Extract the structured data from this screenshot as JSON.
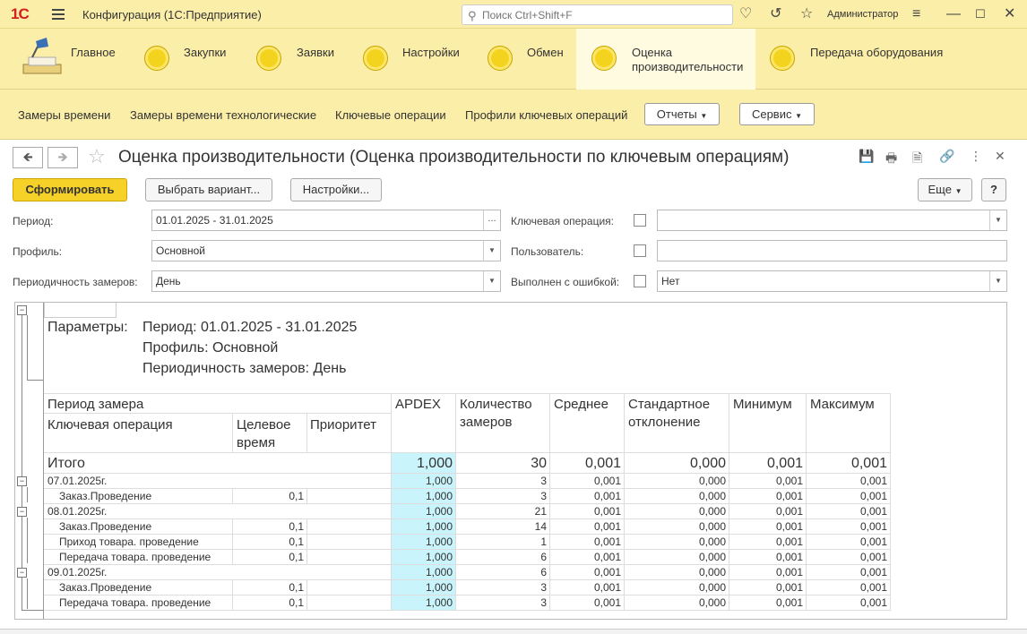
{
  "titlebar": {
    "logo": "1С",
    "app_title": "Конфигурация  (1С:Предприятие)",
    "search_placeholder": "Поиск Ctrl+Shift+F",
    "user": "Администратор"
  },
  "sections": [
    {
      "label": "Главное"
    },
    {
      "label": "Закупки"
    },
    {
      "label": "Заявки"
    },
    {
      "label": "Настройки"
    },
    {
      "label": "Обмен"
    },
    {
      "label_line1": "Оценка",
      "label_line2": "производительности"
    },
    {
      "label": "Передача оборудования"
    }
  ],
  "subnav": {
    "links": [
      "Замеры времени",
      "Замеры времени технологические",
      "Ключевые операции",
      "Профили ключевых операций"
    ],
    "reports": "Отчеты",
    "service": "Сервис"
  },
  "form": {
    "title": "Оценка производительности (Оценка производительности по ключевым операциям)",
    "generate": "Сформировать",
    "choose_variant": "Выбрать вариант...",
    "settings": "Настройки...",
    "more": "Еще",
    "help": "?",
    "period_label": "Период:",
    "period_value": "01.01.2025 - 31.01.2025",
    "period_btn": "...",
    "profile_label": "Профиль:",
    "profile_value": "Основной",
    "periodicity_label": "Периодичность замеров:",
    "periodicity_value": "День",
    "keyop_label": "Ключевая операция:",
    "keyop_value": "",
    "user_label": "Пользователь:",
    "user_value": "",
    "error_label": "Выполнен с ошибкой:",
    "error_value": "Нет"
  },
  "report": {
    "params_label": "Параметры:",
    "params": [
      "Период: 01.01.2025 - 31.01.2025",
      "Профиль: Основной",
      "Периодичность замеров: День"
    ],
    "headers": {
      "period": "Период замера",
      "keyop": "Ключевая операция",
      "target1": "Целевое",
      "target2": "время",
      "priority": "Приоритет",
      "apdex": "APDEX",
      "count1": "Количество",
      "count2": "замеров",
      "avg": "Среднее",
      "std1": "Стандартное",
      "std2": "отклонение",
      "min": "Минимум",
      "max": "Максимум"
    },
    "total": {
      "label": "Итого",
      "apdex": "1,000",
      "count": "30",
      "avg": "0,001",
      "std": "0,000",
      "min": "0,001",
      "max": "0,001"
    },
    "rows": [
      {
        "label": "07.01.2025г.",
        "target": "",
        "apdex": "1,000",
        "count": "3",
        "avg": "0,001",
        "std": "0,000",
        "min": "0,001",
        "max": "0,001"
      },
      {
        "label": "Заказ.Проведение",
        "target": "0,1",
        "apdex": "1,000",
        "count": "3",
        "avg": "0,001",
        "std": "0,000",
        "min": "0,001",
        "max": "0,001"
      },
      {
        "label": "08.01.2025г.",
        "target": "",
        "apdex": "1,000",
        "count": "21",
        "avg": "0,001",
        "std": "0,000",
        "min": "0,001",
        "max": "0,001"
      },
      {
        "label": "Заказ.Проведение",
        "target": "0,1",
        "apdex": "1,000",
        "count": "14",
        "avg": "0,001",
        "std": "0,000",
        "min": "0,001",
        "max": "0,001"
      },
      {
        "label": "Приход товара. проведение",
        "target": "0,1",
        "apdex": "1,000",
        "count": "1",
        "avg": "0,001",
        "std": "0,000",
        "min": "0,001",
        "max": "0,001"
      },
      {
        "label": "Передача товара. проведение",
        "target": "0,1",
        "apdex": "1,000",
        "count": "6",
        "avg": "0,001",
        "std": "0,000",
        "min": "0,001",
        "max": "0,001"
      },
      {
        "label": "09.01.2025г.",
        "target": "",
        "apdex": "1,000",
        "count": "6",
        "avg": "0,001",
        "std": "0,000",
        "min": "0,001",
        "max": "0,001"
      },
      {
        "label": "Заказ.Проведение",
        "target": "0,1",
        "apdex": "1,000",
        "count": "3",
        "avg": "0,001",
        "std": "0,000",
        "min": "0,001",
        "max": "0,001"
      },
      {
        "label": "Передача товара. проведение",
        "target": "0,1",
        "apdex": "1,000",
        "count": "3",
        "avg": "0,001",
        "std": "0,000",
        "min": "0,001",
        "max": "0,001"
      }
    ]
  }
}
